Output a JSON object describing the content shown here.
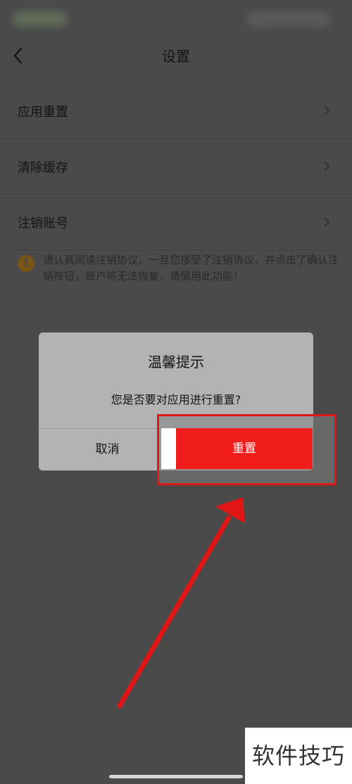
{
  "header": {
    "title": "设置"
  },
  "settings": {
    "items": [
      {
        "label": "应用重置"
      },
      {
        "label": "清除缓存"
      },
      {
        "label": "注销账号"
      }
    ],
    "warning": "请认真阅读注销协议，一旦您接受了注销协议，并点击了确认注销按钮，账户将无法恢复，请慎用此功能！"
  },
  "dialog": {
    "title": "温馨提示",
    "message": "您是否要对应用进行重置?",
    "cancel_label": "取消",
    "confirm_label": "重置"
  },
  "watermark": "软件技巧",
  "colors": {
    "accent": "#f11c1c",
    "annotation": "#e01515",
    "overlay": "#4a4a4a"
  }
}
